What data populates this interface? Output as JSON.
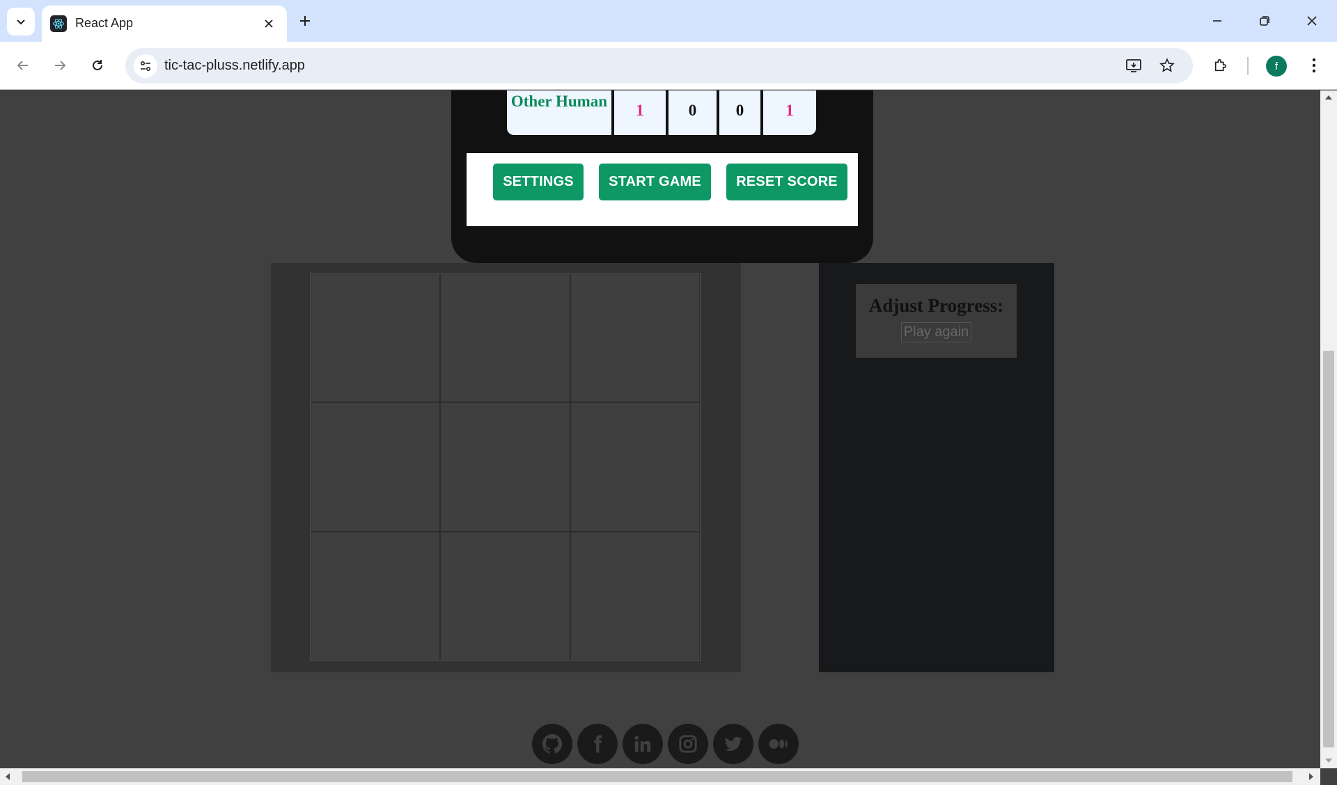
{
  "browser": {
    "tab_title": "React App",
    "url": "tic-tac-pluss.netlify.app",
    "profile_initial": "f"
  },
  "scoreboard": {
    "player_name": "Other Human",
    "scores": [
      "1",
      "0",
      "0",
      "1"
    ]
  },
  "controls": {
    "settings_label": "SETTINGS",
    "start_label": "START GAME",
    "reset_label": "RESET SCORE"
  },
  "board": {
    "cells": [
      "",
      "",
      "",
      "",
      "",
      "",
      "",
      "",
      ""
    ]
  },
  "progress": {
    "title": "Adjust Progress:",
    "play_again_label": "Play again"
  },
  "footer": {
    "social_icons": [
      "github-icon",
      "facebook-icon",
      "linkedin-icon",
      "instagram-icon",
      "twitter-icon",
      "medium-icon"
    ]
  },
  "colors": {
    "accent_green": "#0d9866",
    "score_pink": "#e8257c",
    "player_green": "#0b8a5a",
    "page_background": "#404040"
  }
}
